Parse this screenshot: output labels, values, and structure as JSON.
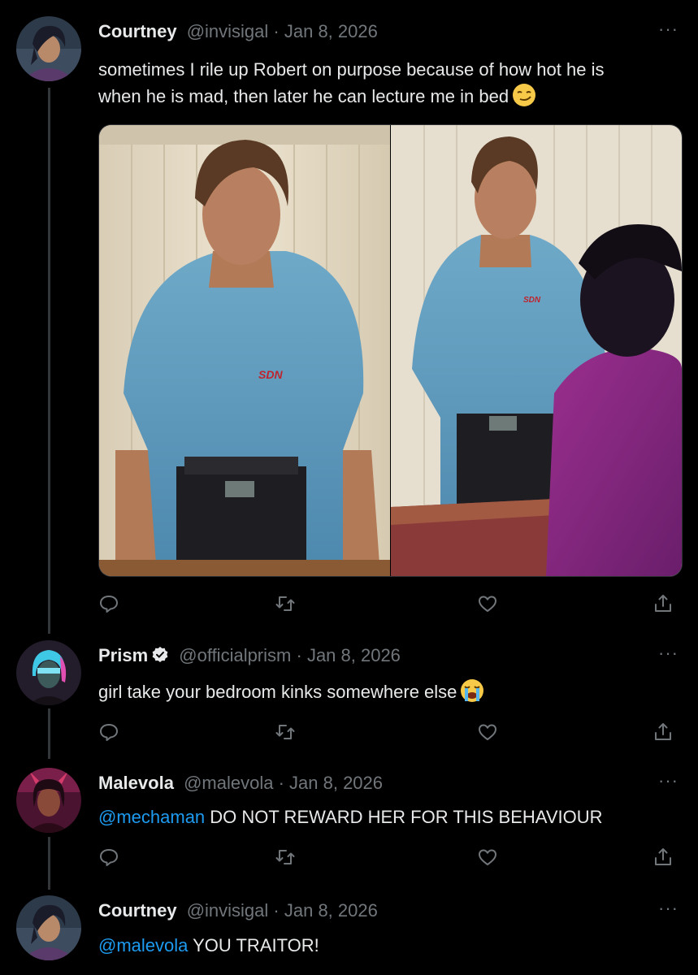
{
  "tweets": [
    {
      "name": "Courtney",
      "handle": "@invisigal",
      "sep": "·",
      "date": "Jan 8, 2026",
      "text_line1": "sometimes I rile up Robert on purpose because of how hot he is",
      "text_line2": "when he is mad, then later he can lecture me in bed",
      "emoji": "smirking-face",
      "more": "···"
    },
    {
      "name": "Prism",
      "handle": "@officialprism",
      "sep": "·",
      "date": "Jan 8, 2026",
      "verified": true,
      "text": "girl take your bedroom kinks somewhere else",
      "emoji": "loudly-crying-face",
      "more": "···"
    },
    {
      "name": "Malevola",
      "handle": "@malevola",
      "sep": "·",
      "date": "Jan 8, 2026",
      "mention": "@mechaman",
      "text": " DO NOT REWARD HER FOR THIS BEHAVIOUR",
      "more": "···"
    },
    {
      "name": "Courtney",
      "handle": "@invisigal",
      "sep": "·",
      "date": "Jan 8, 2026",
      "mention": "@malevola",
      "text": " YOU TRAITOR!",
      "more": "···"
    }
  ],
  "colors": {
    "background": "#000000",
    "text": "#e7e9ea",
    "meta": "#71767b",
    "link": "#1d9bf0",
    "divider": "#2f3336"
  },
  "action_icons": [
    "reply-icon",
    "retweet-icon",
    "like-icon",
    "share-icon"
  ]
}
